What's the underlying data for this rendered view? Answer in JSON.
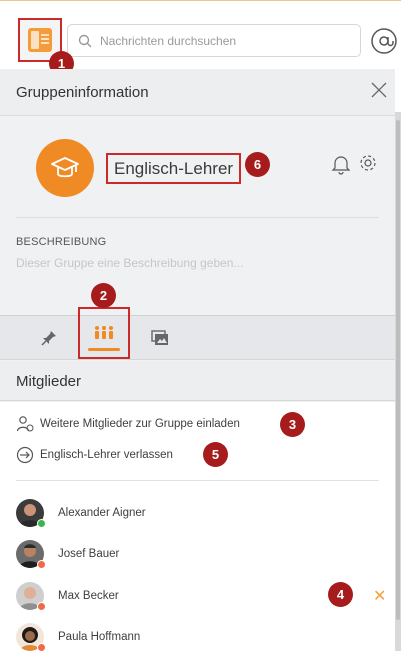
{
  "search": {
    "placeholder": "Nachrichten durchsuchen"
  },
  "markers": [
    "1",
    "2",
    "3",
    "4",
    "5",
    "6"
  ],
  "panel": {
    "title": "Gruppeninformation",
    "group_name": "Englisch-Lehrer",
    "description_label": "BESCHREIBUNG",
    "description_placeholder": "Dieser Gruppe eine Beschreibung geben..."
  },
  "tabs": [
    {
      "icon": "pin-icon"
    },
    {
      "icon": "members-icon",
      "active": true
    },
    {
      "icon": "media-icon"
    }
  ],
  "members_section": {
    "heading": "Mitglieder",
    "invite_label": "Weitere Mitglieder zur Gruppe einladen",
    "leave_label": "Englisch-Lehrer verlassen"
  },
  "members": [
    {
      "name": "Alexander Aigner",
      "status_color": "#3cb44b"
    },
    {
      "name": "Josef Bauer",
      "status_color": "#f06a4a"
    },
    {
      "name": "Max Becker",
      "status_color": "#f06a4a"
    },
    {
      "name": "Paula Hoffmann",
      "status_color": "#f06a4a"
    }
  ],
  "colors": {
    "accent": "#f08a24",
    "marker": "#a61b1b",
    "highlight_border": "#cc2a2a"
  }
}
